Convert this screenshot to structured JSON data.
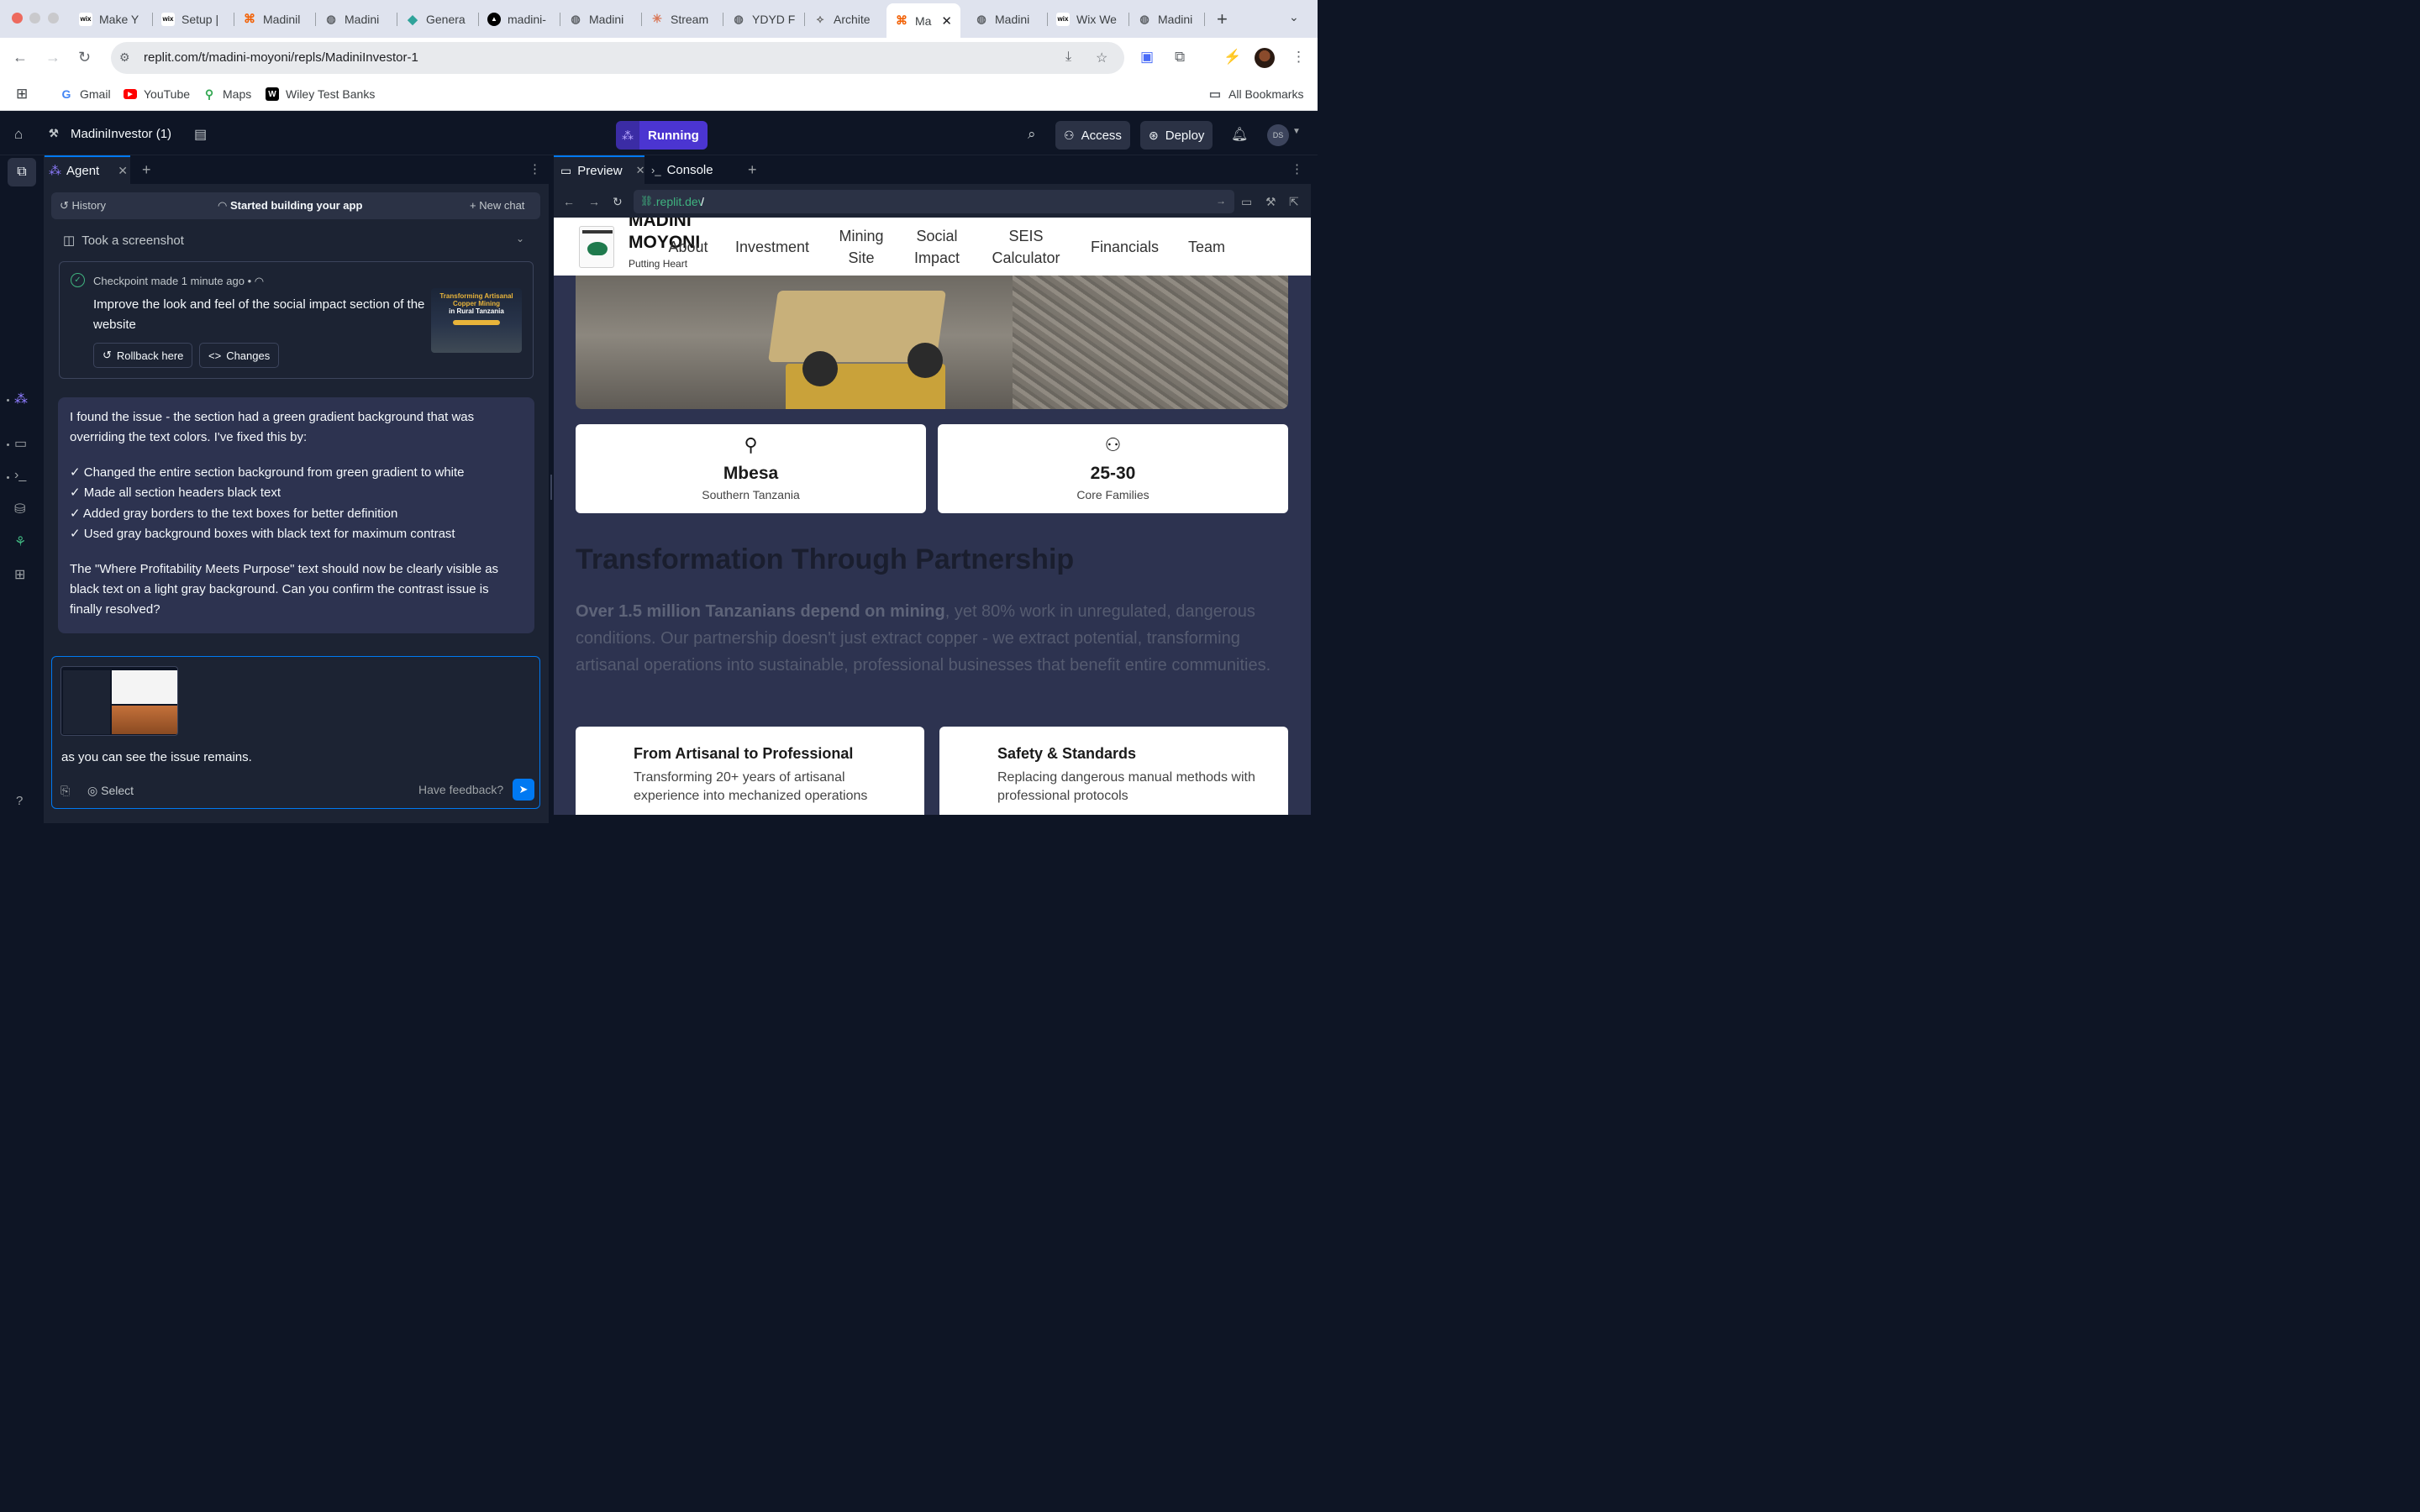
{
  "browser": {
    "tabs": [
      {
        "title": "Make Y",
        "icon": "wix"
      },
      {
        "title": "Setup |",
        "icon": "wix"
      },
      {
        "title": "Madinil",
        "icon": "replit"
      },
      {
        "title": "Madini",
        "icon": "globe"
      },
      {
        "title": "Genera",
        "icon": "diamond"
      },
      {
        "title": "madini-",
        "icon": "vercel"
      },
      {
        "title": "Madini",
        "icon": "globe"
      },
      {
        "title": "Stream",
        "icon": "claude"
      },
      {
        "title": "YDYD F",
        "icon": "globe"
      },
      {
        "title": "Archite",
        "icon": "arch"
      },
      {
        "title": "Ma",
        "icon": "replit",
        "active": true
      },
      {
        "title": "Madini",
        "icon": "globe"
      },
      {
        "title": "Wix We",
        "icon": "wix"
      },
      {
        "title": "Madini",
        "icon": "globe"
      }
    ],
    "url": "replit.com/t/madini-moyoni/repls/MadiniInvestor-1",
    "bookmarks": [
      "Gmail",
      "YouTube",
      "Maps",
      "Wiley Test Banks"
    ],
    "all_bookmarks": "All Bookmarks"
  },
  "replit": {
    "project_name": "MadiniInvestor (1)",
    "run_status": "Running",
    "access_label": "Access",
    "deploy_label": "Deploy",
    "avatar_initials": "DS"
  },
  "agent": {
    "tab_label": "Agent",
    "history_label": "History",
    "status_label": "Started building your app",
    "new_chat_label": "New chat",
    "screenshot_label": "Took a screenshot",
    "checkpoint": {
      "meta": "Checkpoint made 1 minute ago",
      "title": "Improve the look and feel of the social impact section of the website",
      "rollback_label": "Rollback here",
      "changes_label": "Changes",
      "thumb_title": "Transforming Artisanal Copper Mining",
      "thumb_subtitle": "in Rural Tanzania"
    },
    "message": {
      "intro": "I found the issue - the section had a green gradient background that was overriding the text colors. I've fixed this by:",
      "items": [
        "✓ Changed the entire section background from green gradient to white",
        "✓ Made all section headers black text",
        "✓ Added gray borders to the text boxes for better definition",
        "✓ Used gray background boxes with black text for maximum contrast"
      ],
      "outro": "The \"Where Profitability Meets Purpose\" text should now be clearly visible as black text on a light gray background. Can you confirm the contrast issue is finally resolved?"
    },
    "composer": {
      "text": "as you can see the issue remains.",
      "select_label": "Select",
      "feedback_label": "Have feedback?"
    }
  },
  "preview": {
    "tab_preview": "Preview",
    "tab_console": "Console",
    "url_domain": ".replit.dev",
    "url_path": "/",
    "site": {
      "brand": "MADINI MOYONI",
      "tagline": "Putting Heart",
      "nav": [
        "About",
        "Investment",
        "Mining Site",
        "Social Impact",
        "SEIS Calculator",
        "Financials",
        "Team"
      ],
      "stats": [
        {
          "value": "Mbesa",
          "label": "Southern Tanzania",
          "icon": "map-pin-icon"
        },
        {
          "value": "25-30",
          "label": "Core Families",
          "icon": "users-icon"
        }
      ],
      "section_title": "Transformation Through Partnership",
      "section_lead": "Over 1.5 million Tanzanians depend on mining",
      "section_body": ", yet 80% work in unregulated, dangerous conditions. Our partnership doesn't just extract copper - we extract potential, transforming artisanal operations into sustainable, professional businesses that benefit entire communities.",
      "cards": [
        {
          "title": "From Artisanal to Professional",
          "desc": "Transforming 20+ years of artisanal experience into mechanized operations"
        },
        {
          "title": "Safety & Standards",
          "desc": "Replacing dangerous manual methods with professional protocols"
        }
      ]
    }
  },
  "colors": {
    "accent": "#0079f2",
    "run_purple": "#4b35d1",
    "bg_dark": "#0e1525",
    "panel": "#1c2333",
    "chat_bubble": "#2d3350"
  }
}
